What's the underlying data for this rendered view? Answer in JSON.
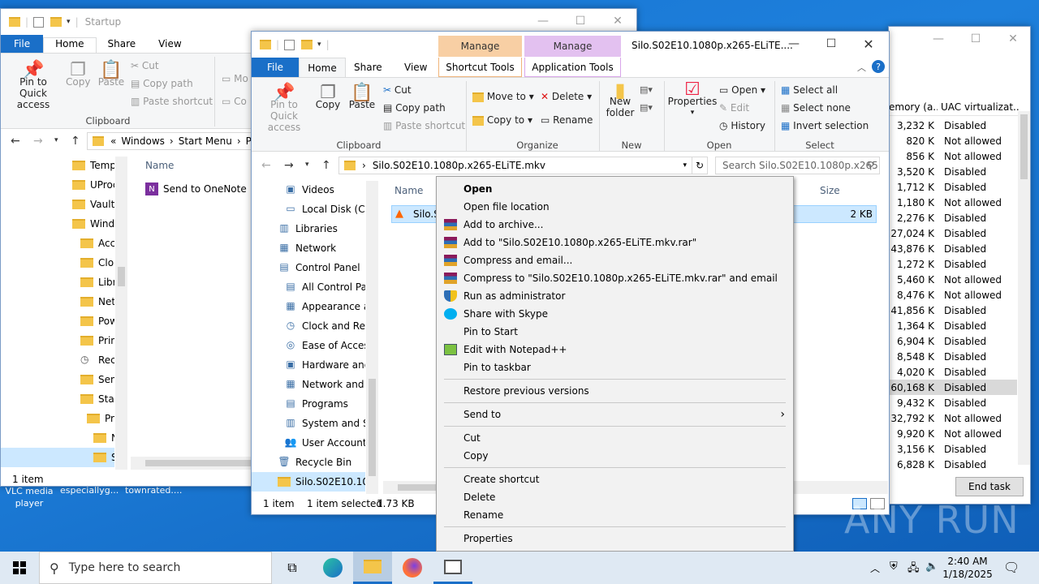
{
  "win1": {
    "title": "Startup",
    "menu": [
      "File",
      "Home",
      "Share",
      "View"
    ],
    "ribbon": {
      "pin": "Pin to Quick access",
      "copy": "Copy",
      "paste": "Paste",
      "cut": "Cut",
      "copy_path": "Copy path",
      "paste_shortcut": "Paste shortcut",
      "group": "Clipboard",
      "move_partial": "Mo",
      "copy_partial": "Co"
    },
    "address": [
      "«",
      "Windows",
      "›",
      "Start Menu",
      "›",
      "Pr"
    ],
    "tree": [
      "Temp",
      "UProc",
      "Vault",
      "Windo",
      "Acce",
      "Clou",
      "Libra",
      "Netw",
      "Pow",
      "Print",
      "Rece",
      "Send",
      "Start",
      "Pro",
      "N",
      "S"
    ],
    "column_name": "Name",
    "files": [
      "Send to OneNote"
    ],
    "status": "1 item"
  },
  "win2": {
    "title": "Silo.S02E10.1080p.x265-ELiTE....",
    "context_tabs": [
      {
        "label": "Manage",
        "sub": "Shortcut Tools"
      },
      {
        "label": "Manage",
        "sub": "Application Tools"
      }
    ],
    "menu": [
      "File",
      "Home",
      "Share",
      "View"
    ],
    "ribbon": {
      "pin": "Pin to Quick access",
      "copy": "Copy",
      "paste": "Paste",
      "cut": "Cut",
      "copy_path": "Copy path",
      "paste_shortcut": "Paste shortcut",
      "move_to": "Move to",
      "copy_to": "Copy to",
      "delete": "Delete",
      "rename": "Rename",
      "new_folder": "New folder",
      "properties": "Properties",
      "open": "Open",
      "edit": "Edit",
      "history": "History",
      "select_all": "Select all",
      "select_none": "Select none",
      "invert_selection": "Invert selection",
      "groups": [
        "Clipboard",
        "Organize",
        "New",
        "Open",
        "Select"
      ]
    },
    "address": "Silo.S02E10.1080p.x265-ELiTE.mkv",
    "search_placeholder": "Search Silo.S02E10.1080p.x265...",
    "tree": [
      "Videos",
      "Local Disk (C:)",
      "Libraries",
      "Network",
      "Control Panel",
      "All Control Par",
      "Appearance an",
      "Clock and Regi",
      "Ease of Access",
      "Hardware and",
      "Network and Ir",
      "Programs",
      "System and Se",
      "User Accounts",
      "Recycle Bin",
      "Silo.S02E10.1080"
    ],
    "columns": {
      "name": "Name",
      "size": "Size"
    },
    "file": {
      "name": "Silo.S",
      "size": "2 KB"
    },
    "status": {
      "count": "1 item",
      "selected": "1 item selected",
      "size": "1.73 KB"
    }
  },
  "context_menu": {
    "items": [
      {
        "label": "Open",
        "bold": true,
        "icon": ""
      },
      {
        "label": "Open file location",
        "icon": ""
      },
      {
        "label": "Add to archive...",
        "icon": "winrar-icon"
      },
      {
        "label": "Add to \"Silo.S02E10.1080p.x265-ELiTE.mkv.rar\"",
        "icon": "winrar-icon"
      },
      {
        "label": "Compress and email...",
        "icon": "winrar-icon"
      },
      {
        "label": "Compress to \"Silo.S02E10.1080p.x265-ELiTE.mkv.rar\" and email",
        "icon": "winrar-icon"
      },
      {
        "label": "Run as administrator",
        "icon": "shield-icon"
      },
      {
        "label": "Share with Skype",
        "icon": "skype-icon"
      },
      {
        "label": "Pin to Start",
        "icon": ""
      },
      {
        "label": "Edit with Notepad++",
        "icon": "notepad-icon"
      },
      {
        "label": "Pin to taskbar",
        "icon": ""
      }
    ],
    "group2": [
      "Restore previous versions"
    ],
    "group3": [
      "Send to"
    ],
    "group4": [
      "Cut",
      "Copy"
    ],
    "group5": [
      "Create shortcut",
      "Delete",
      "Rename"
    ],
    "group6": [
      "Properties"
    ]
  },
  "taskmgr": {
    "col_mem": "emory (a...",
    "col_uac": "UAC virtualizat...",
    "rows": [
      [
        "3,232 K",
        "Disabled"
      ],
      [
        "820 K",
        "Not allowed"
      ],
      [
        "856 K",
        "Not allowed"
      ],
      [
        "3,520 K",
        "Disabled"
      ],
      [
        "1,712 K",
        "Disabled"
      ],
      [
        "1,180 K",
        "Not allowed"
      ],
      [
        "2,276 K",
        "Disabled"
      ],
      [
        "27,024 K",
        "Disabled"
      ],
      [
        "43,876 K",
        "Disabled"
      ],
      [
        "1,272 K",
        "Disabled"
      ],
      [
        "5,460 K",
        "Not allowed"
      ],
      [
        "8,476 K",
        "Not allowed"
      ],
      [
        "41,856 K",
        "Disabled"
      ],
      [
        "1,364 K",
        "Disabled"
      ],
      [
        "6,904 K",
        "Disabled"
      ],
      [
        "8,548 K",
        "Disabled"
      ],
      [
        "4,020 K",
        "Disabled"
      ],
      [
        "60,168 K",
        "Disabled"
      ],
      [
        "9,432 K",
        "Disabled"
      ],
      [
        "32,792 K",
        "Not allowed"
      ],
      [
        "9,920 K",
        "Not allowed"
      ],
      [
        "3,156 K",
        "Disabled"
      ],
      [
        "6,828 K",
        "Disabled"
      ]
    ],
    "end_task": "End task"
  },
  "desktop_labels": [
    "VLC media player",
    "especiallyg...",
    "townrated...."
  ],
  "taskbar": {
    "search_placeholder": "Type here to search",
    "time": "2:40 AM",
    "date": "1/18/2025"
  },
  "watermark": "ANY RUN"
}
